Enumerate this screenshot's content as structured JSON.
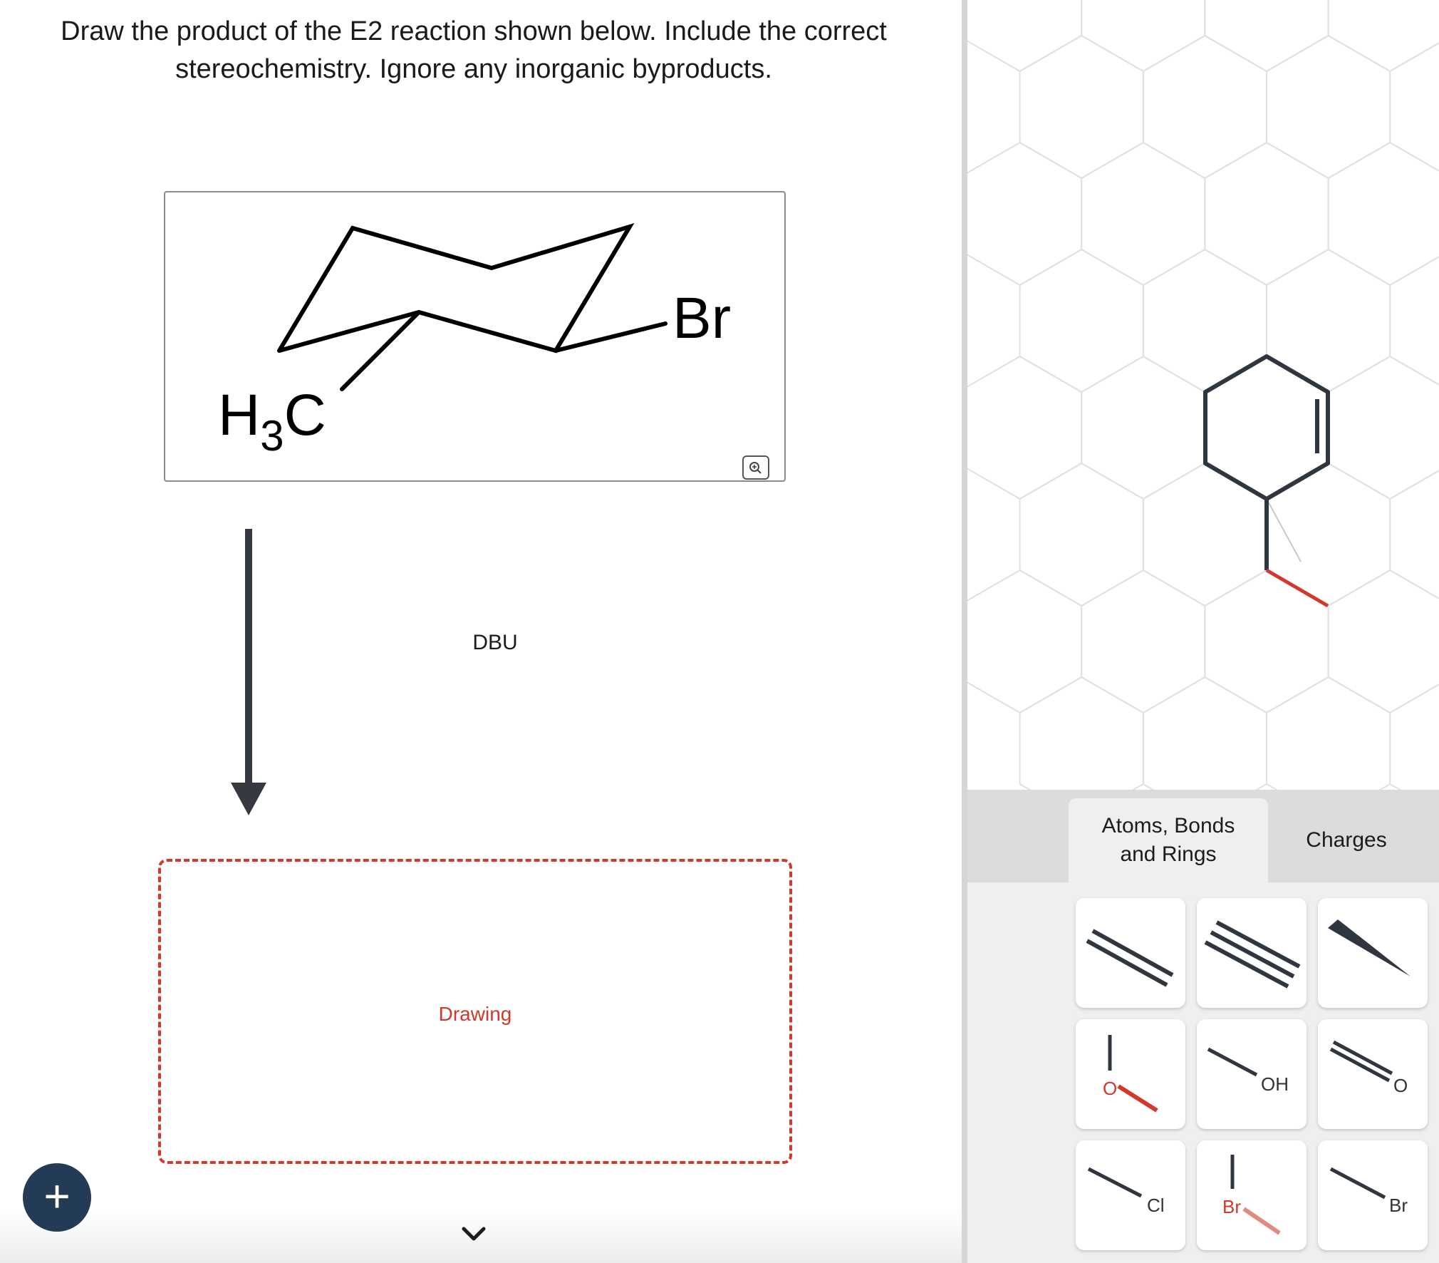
{
  "question": {
    "line1": "Draw the product of the E2 reaction shown below. Include the correct",
    "line2": "stereochemistry. Ignore any inorganic byproducts."
  },
  "reactant": {
    "methyl_label_main": "H",
    "methyl_label_sub": "3",
    "methyl_label_tail": "C",
    "bromine_label": "Br",
    "zoom_icon": "zoom-in-icon"
  },
  "reagent": "DBU",
  "drawing_area": {
    "label": "Drawing"
  },
  "controls": {
    "add_icon": "plus-icon",
    "add_symbol": "+",
    "expand_icon": "chevron-down-icon"
  },
  "toolbar": {
    "tabs": [
      {
        "label": "Atoms, Bonds and Rings",
        "line1": "Atoms, Bonds",
        "line2": "and Rings",
        "active": true
      },
      {
        "label": "Charges",
        "active": false
      }
    ],
    "tools": [
      {
        "name": "double-bond",
        "icon": "double-bond-icon"
      },
      {
        "name": "triple-bond",
        "icon": "triple-bond-icon"
      },
      {
        "name": "wedge-bond",
        "icon": "wedge-bond-icon"
      },
      {
        "name": "ether",
        "icon": "ether-icon",
        "label": "O"
      },
      {
        "name": "hydroxyl",
        "icon": "hydroxyl-icon",
        "label": "OH"
      },
      {
        "name": "carbonyl",
        "icon": "carbonyl-icon",
        "label": "O"
      },
      {
        "name": "chloro",
        "icon": "chloro-icon",
        "label": "Cl"
      },
      {
        "name": "bromo-vertical",
        "icon": "bromo-icon",
        "label": "Br"
      },
      {
        "name": "bromo",
        "icon": "bromo-icon",
        "label": "Br"
      }
    ]
  },
  "colors": {
    "accent_red": "#d0392b",
    "dark_navy": "#243b55",
    "bond_dark": "#2f3640",
    "grid_line": "#e0e0e0"
  }
}
